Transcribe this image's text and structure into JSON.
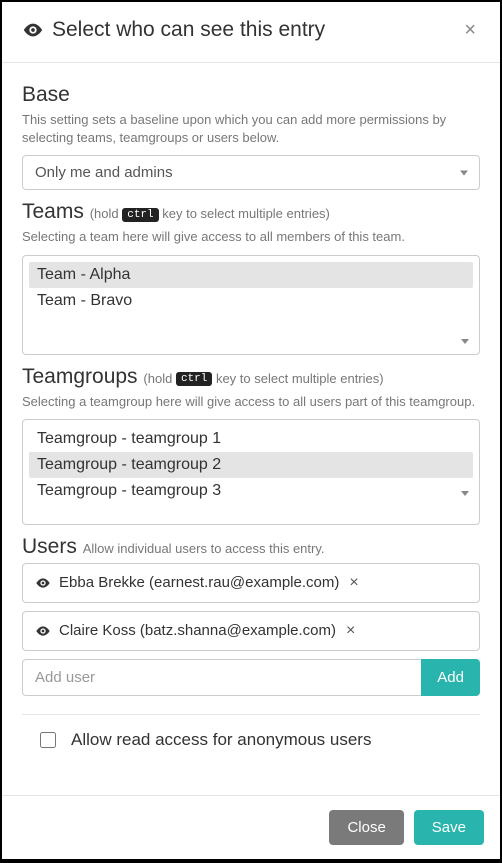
{
  "header": {
    "title": "Select who can see this entry"
  },
  "base": {
    "heading": "Base",
    "help": "This setting sets a baseline upon which you can add more permissions by selecting teams, teamgroups or users below.",
    "value": "Only me and admins"
  },
  "teams": {
    "heading": "Teams",
    "ctrl_key": "ctrl",
    "hint_prefix": "(hold ",
    "hint_suffix": " key to select multiple entries)",
    "help": "Selecting a team here will give access to all members of this team.",
    "items": [
      {
        "label": "Team - Alpha",
        "selected": true
      },
      {
        "label": "Team - Bravo",
        "selected": false
      }
    ]
  },
  "teamgroups": {
    "heading": "Teamgroups",
    "ctrl_key": "ctrl",
    "hint_prefix": "(hold ",
    "hint_suffix": " key to select multiple entries)",
    "help": "Selecting a teamgroup here will give access to all users part of this teamgroup.",
    "items": [
      {
        "label": "Teamgroup - teamgroup 1",
        "selected": false
      },
      {
        "label": "Teamgroup - teamgroup 2",
        "selected": true
      },
      {
        "label": "Teamgroup - teamgroup 3",
        "selected": false
      }
    ]
  },
  "users": {
    "heading": "Users",
    "sub": "Allow individual users to access this entry.",
    "chips": [
      {
        "label": "Ebba Brekke (earnest.rau@example.com)"
      },
      {
        "label": "Claire Koss (batz.shanna@example.com)"
      }
    ],
    "add_placeholder": "Add user",
    "add_button": "Add"
  },
  "anon": {
    "label": "Allow read access for anonymous users",
    "checked": false
  },
  "footer": {
    "close": "Close",
    "save": "Save"
  }
}
